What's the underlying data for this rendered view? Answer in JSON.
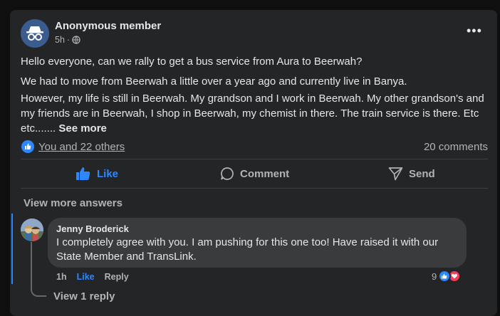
{
  "post": {
    "author": "Anonymous member",
    "time": "5h",
    "separator": "·",
    "audience_icon": "globe-icon",
    "menu_icon": "more-options-icon",
    "paragraphs": [
      "Hello everyone,  can we rally to get a bus service from Aura to Beerwah?",
      "We had to move from Beerwah a little over a year ago and currently live in Banya.",
      "However, my life is still in Beerwah. My grandson and I work in Beerwah. My other grandson's and my friends are in Beerwah, I shop in Beerwah, my chemist in there.  The train service is there. Etc etc....... "
    ],
    "see_more": "See more",
    "reactions_text": "You and 22 others",
    "comments_count": "20 comments"
  },
  "actions": {
    "like": "Like",
    "comment": "Comment",
    "send": "Send"
  },
  "comments_section": {
    "view_more": "View more answers",
    "comment": {
      "author": "Jenny Broderick",
      "text": "I completely agree with you. I am pushing for this one too! Have raised it with our State Member and TransLink.",
      "time": "1h",
      "like": "Like",
      "reply": "Reply",
      "reaction_count": "9"
    },
    "view_reply": "View 1 reply"
  },
  "colors": {
    "accent": "#2d88ff",
    "background": "#242526",
    "bubble": "#3a3b3c",
    "love": "#f33e58"
  }
}
